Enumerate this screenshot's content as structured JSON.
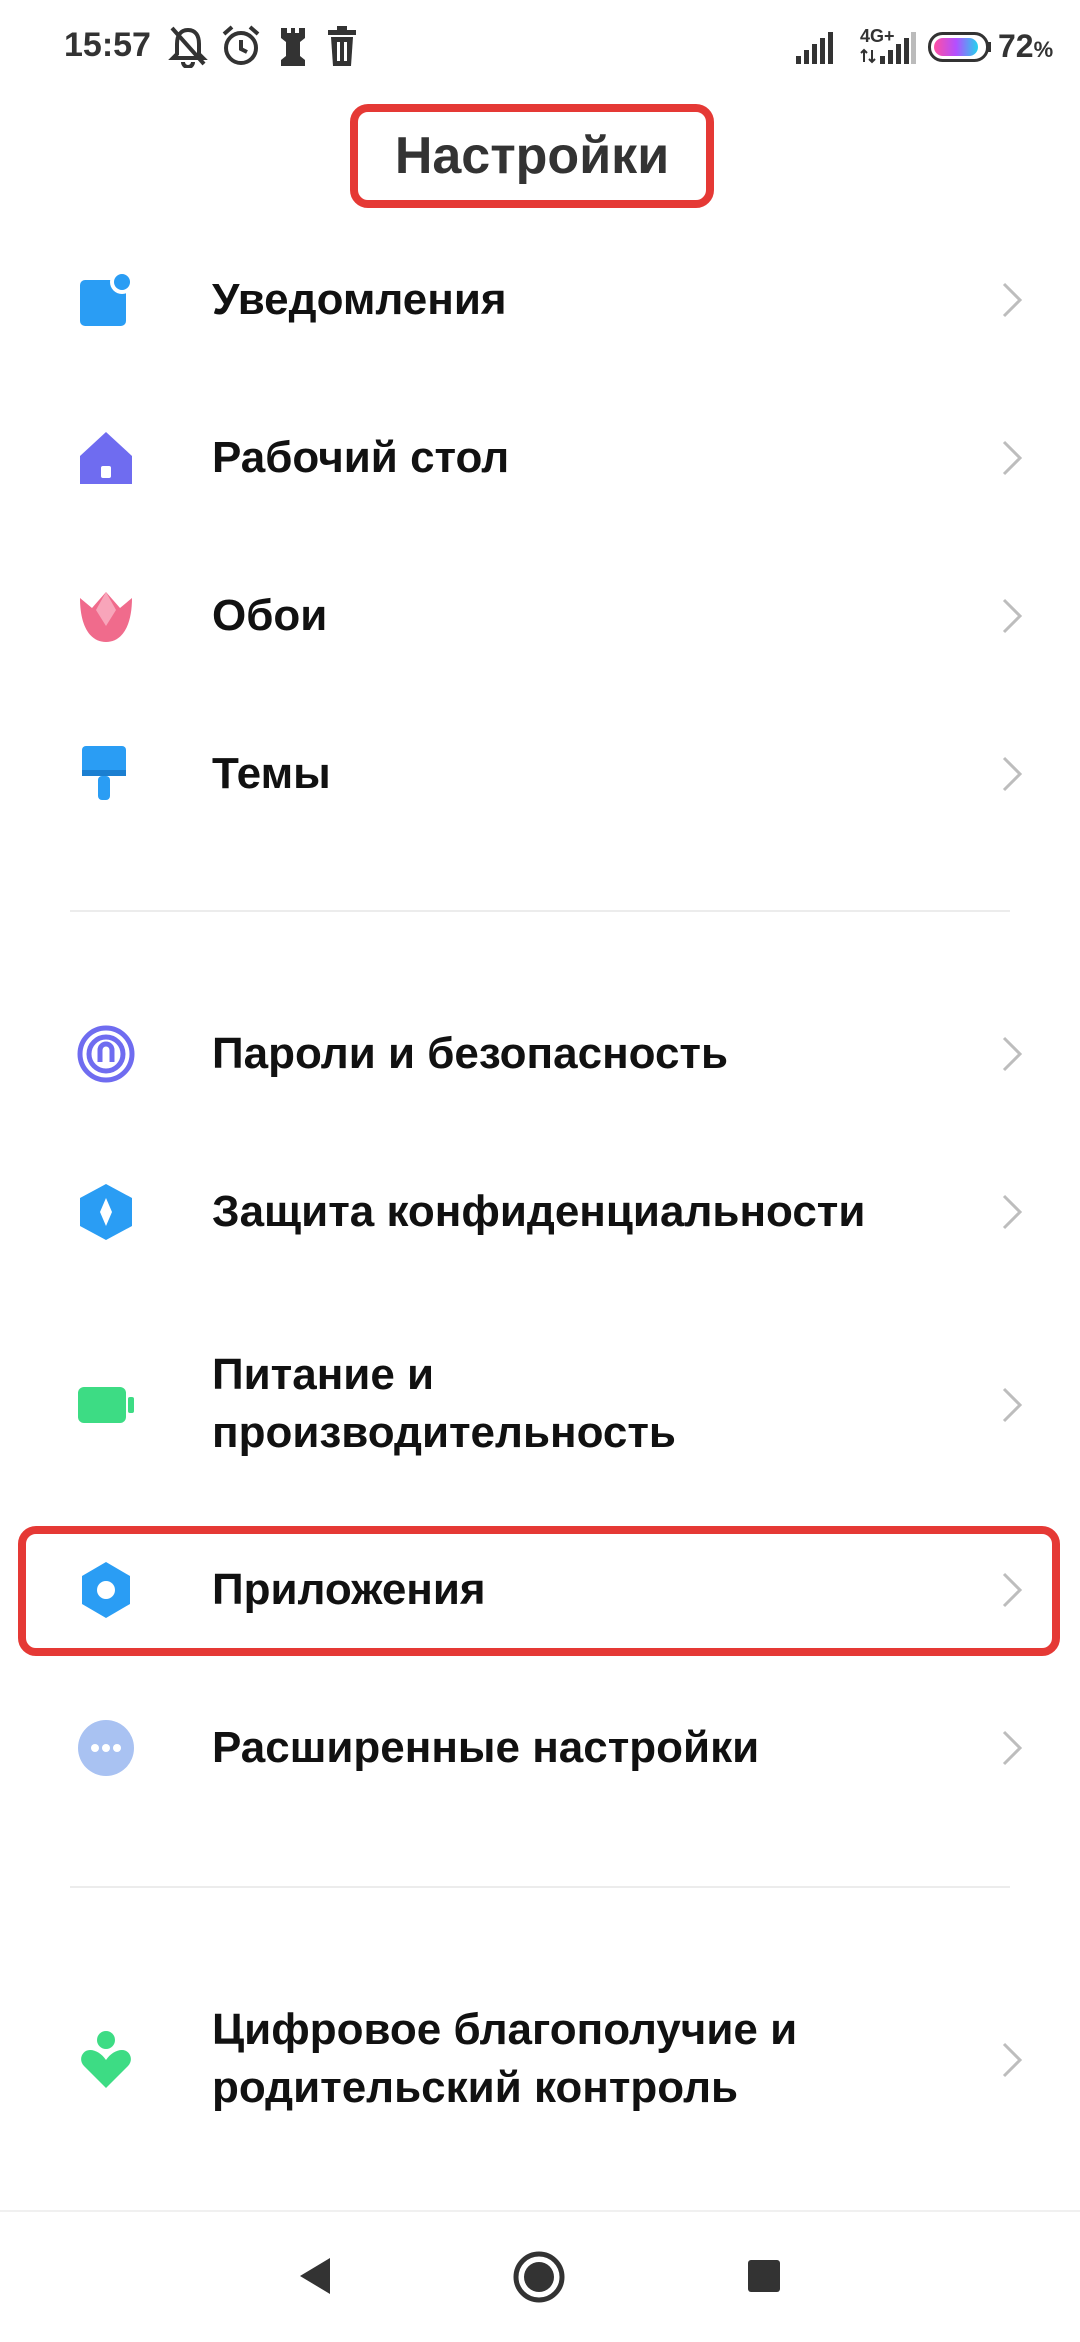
{
  "status": {
    "time": "15:57",
    "network": "4G+",
    "battery_percent": "72",
    "battery_unit": "%"
  },
  "header": {
    "title": "Настройки"
  },
  "sections": [
    {
      "items": [
        {
          "label": "Уведомления",
          "icon": "notification-icon"
        },
        {
          "label": "Рабочий стол",
          "icon": "home-icon"
        },
        {
          "label": "Обои",
          "icon": "tulip-icon"
        },
        {
          "label": "Темы",
          "icon": "paintbrush-icon"
        }
      ]
    },
    {
      "items": [
        {
          "label": "Пароли и безопасность",
          "icon": "fingerprint-icon"
        },
        {
          "label": "Защита конфиденциальности",
          "icon": "privacy-shield-icon"
        },
        {
          "label_line1": "Питание и",
          "label_line2": "производительность",
          "icon": "battery-icon"
        },
        {
          "label": "Приложения",
          "icon": "gear-icon"
        },
        {
          "label": "Расширенные настройки",
          "icon": "more-icon"
        }
      ]
    },
    {
      "items": [
        {
          "label_line1": "Цифровое благополучие и",
          "label_line2": "родительский контроль",
          "icon": "wellbeing-icon"
        }
      ]
    }
  ],
  "colors": {
    "highlight": "#e53935",
    "blue": "#2a9df4",
    "purple": "#6f6cf0",
    "pink": "#f06b8c",
    "green": "#3ddc84"
  }
}
